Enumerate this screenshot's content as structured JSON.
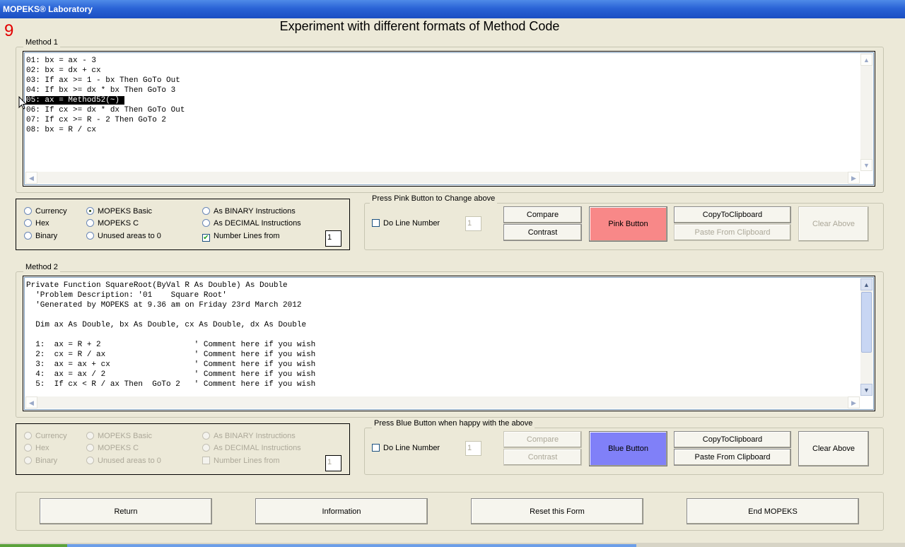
{
  "window": {
    "title": "MOPEKS® Laboratory"
  },
  "step_number": "9",
  "page_title": "Experiment with different formats of Method Code",
  "method1": {
    "legend": "Method 1",
    "code_before": "01: bx = ax - 3\n02: bx = dx + cx\n03: If ax >= 1 - bx Then GoTo Out\n04: If bx >= dx * bx Then GoTo 3\n",
    "code_selected": "05: ax = Method52(~) ",
    "code_after": "\n06: If cx >= dx * dx Then GoTo Out\n07: If cx >= R - 2 Then GoTo 2\n08: bx = R / cx"
  },
  "options1": {
    "currency": "Currency",
    "hex": "Hex",
    "binary": "Binary",
    "mopeks_basic": "MOPEKS Basic",
    "mopeks_c": "MOPEKS C",
    "unused_areas": "Unused areas to 0",
    "as_binary": "As BINARY Instructions",
    "as_decimal": "As DECIMAL Instructions",
    "number_lines": "Number Lines  from",
    "number_from": "1",
    "selected": "mopeks_basic",
    "number_lines_checked": true
  },
  "pink_panel": {
    "legend": "Press Pink Button to Change above",
    "do_line_number": "Do Line Number",
    "line_number_value": "1",
    "compare": "Compare",
    "contrast": "Contrast",
    "pink_button": "Pink Button",
    "copy": "CopyToClipboard",
    "paste": "Paste From Clipboard",
    "clear": "Clear Above",
    "pink_color": "#f88888"
  },
  "method2": {
    "legend": "Method 2",
    "code": "Private Function SquareRoot(ByVal R As Double) As Double\n  'Problem Description: '01    Square Root'\n  'Generated by MOPEKS at 9.36 am on Friday 23rd March 2012\n\n  Dim ax As Double, bx As Double, cx As Double, dx As Double\n\n  1:  ax = R + 2                    ' Comment here if you wish\n  2:  cx = R / ax                   ' Comment here if you wish\n  3:  ax = ax + cx                  ' Comment here if you wish\n  4:  ax = ax / 2                   ' Comment here if you wish\n  5:  If cx < R / ax Then  GoTo 2   ' Comment here if you wish"
  },
  "options2": {
    "currency": "Currency",
    "hex": "Hex",
    "binary": "Binary",
    "mopeks_basic": "MOPEKS Basic",
    "mopeks_c": "MOPEKS C",
    "unused_areas": "Unused areas to 0",
    "as_binary": "As BINARY Instructions",
    "as_decimal": "As DECIMAL Instructions",
    "number_lines": "Number Lines  from",
    "number_from": "1"
  },
  "blue_panel": {
    "legend": "Press Blue Button when happy with the above",
    "do_line_number": "Do Line Number",
    "line_number_value": "1",
    "compare": "Compare",
    "contrast": "Contrast",
    "blue_button": "Blue Button",
    "copy": "CopyToClipboard",
    "paste": "Paste From Clipboard",
    "clear": "Clear Above",
    "blue_color": "#8080f8"
  },
  "footer": {
    "return": "Return",
    "information": "Information",
    "reset": "Reset this Form",
    "end": "End MOPEKS"
  }
}
